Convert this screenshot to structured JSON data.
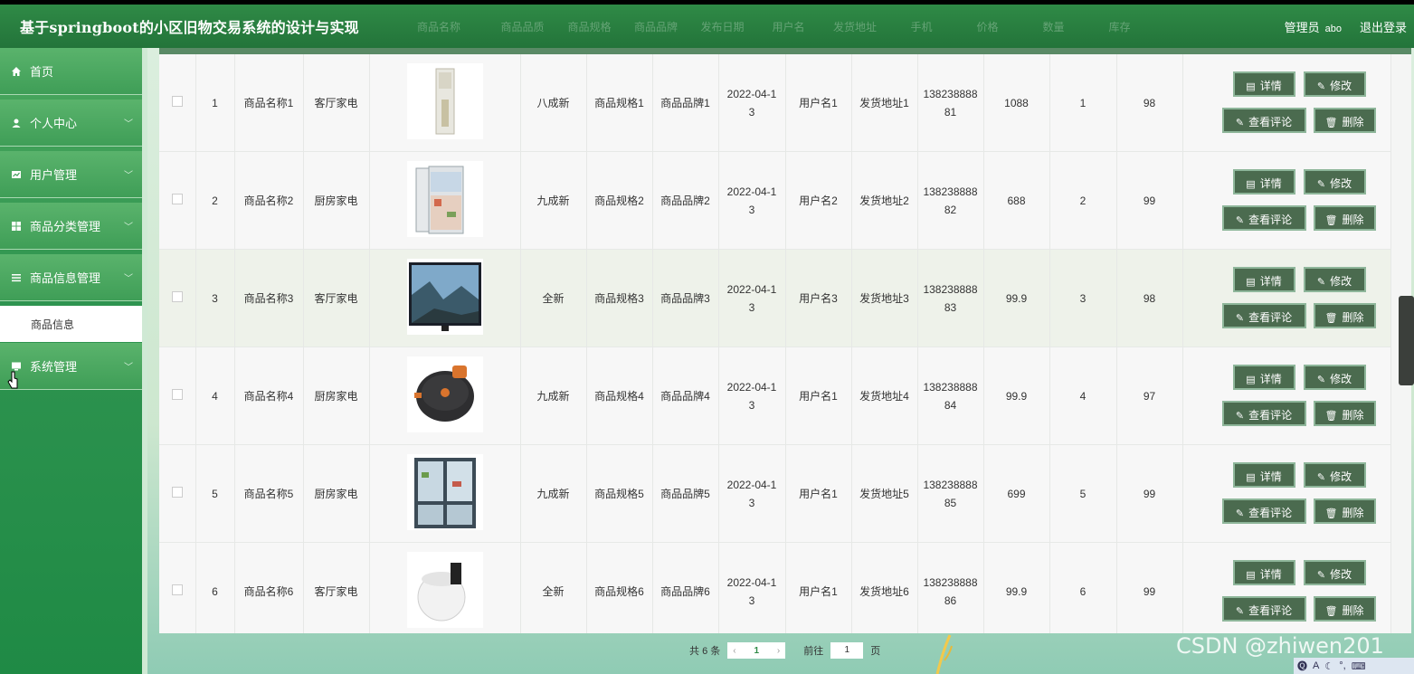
{
  "app": {
    "title": "基于springboot的小区旧物交易系统的设计与实现",
    "user_role": "管理员",
    "user_name": "abo",
    "logout_label": "退出登录"
  },
  "header_columns": [
    "商品名称",
    "商品品质",
    "商品规格",
    "商品品牌",
    "发布日期",
    "用户名",
    "发货地址",
    "手机",
    "价格",
    "数量",
    "库存"
  ],
  "sidebar": {
    "items": [
      {
        "label": "首页",
        "icon": "home-icon",
        "expandable": false
      },
      {
        "label": "个人中心",
        "icon": "user-icon",
        "expandable": true
      },
      {
        "label": "用户管理",
        "icon": "user-manage-icon",
        "expandable": true
      },
      {
        "label": "商品分类管理",
        "icon": "grid-icon",
        "expandable": true
      },
      {
        "label": "商品信息管理",
        "icon": "list-icon",
        "expandable": true,
        "submenu": "商品信息"
      },
      {
        "label": "系统管理",
        "icon": "monitor-icon",
        "expandable": true
      }
    ]
  },
  "rows": [
    {
      "idx": "1",
      "name": "商品名称1",
      "category": "客厅家电",
      "image": "standing-air-conditioner",
      "quality": "八成新",
      "spec": "商品规格1",
      "brand": "商品品牌1",
      "date_a": "2022-04-1",
      "date_b": "3",
      "user": "用户名1",
      "addr": "发货地址1",
      "phone_a": "138238888",
      "phone_b": "81",
      "price": "1088",
      "qty": "1",
      "stock": "98"
    },
    {
      "idx": "2",
      "name": "商品名称2",
      "category": "厨房家电",
      "image": "refrigerator-open",
      "quality": "九成新",
      "spec": "商品规格2",
      "brand": "商品品牌2",
      "date_a": "2022-04-1",
      "date_b": "3",
      "user": "用户名2",
      "addr": "发货地址2",
      "phone_a": "138238888",
      "phone_b": "82",
      "price": "688",
      "qty": "2",
      "stock": "99"
    },
    {
      "idx": "3",
      "name": "商品名称3",
      "category": "客厅家电",
      "image": "television",
      "quality": "全新",
      "spec": "商品规格3",
      "brand": "商品品牌3",
      "date_a": "2022-04-1",
      "date_b": "3",
      "user": "用户名3",
      "addr": "发货地址3",
      "phone_a": "138238888",
      "phone_b": "83",
      "price": "99.9",
      "qty": "3",
      "stock": "98"
    },
    {
      "idx": "4",
      "name": "商品名称4",
      "category": "厨房家电",
      "image": "rice-cooker",
      "quality": "九成新",
      "spec": "商品规格4",
      "brand": "商品品牌4",
      "date_a": "2022-04-1",
      "date_b": "3",
      "user": "用户名1",
      "addr": "发货地址4",
      "phone_a": "138238888",
      "phone_b": "84",
      "price": "99.9",
      "qty": "4",
      "stock": "97"
    },
    {
      "idx": "5",
      "name": "商品名称5",
      "category": "厨房家电",
      "image": "double-door-fridge",
      "quality": "九成新",
      "spec": "商品规格5",
      "brand": "商品品牌5",
      "date_a": "2022-04-1",
      "date_b": "3",
      "user": "用户名1",
      "addr": "发货地址5",
      "phone_a": "138238888",
      "phone_b": "85",
      "price": "699",
      "qty": "5",
      "stock": "99"
    },
    {
      "idx": "6",
      "name": "商品名称6",
      "category": "客厅家电",
      "image": "soymilk-maker",
      "quality": "全新",
      "spec": "商品规格6",
      "brand": "商品品牌6",
      "date_a": "2022-04-1",
      "date_b": "3",
      "user": "用户名1",
      "addr": "发货地址6",
      "phone_a": "138238888",
      "phone_b": "86",
      "price": "99.9",
      "qty": "6",
      "stock": "99"
    }
  ],
  "actions": {
    "detail": "详情",
    "edit": "修改",
    "comments": "查看评论",
    "delete": "删除"
  },
  "pagination": {
    "total_prefix": "共",
    "total": "6",
    "total_suffix": "条",
    "current_page": "1",
    "goto_label": "前往",
    "goto_value": "1",
    "page_suffix": "页",
    "prev_icon": "‹",
    "next_icon": "›"
  },
  "watermark": "CSDN @zhiwen201",
  "colors": {
    "header_bg": "#2f8a46",
    "sidebar_bg": "#3f9e57",
    "button_bg": "#4b6b4f"
  }
}
